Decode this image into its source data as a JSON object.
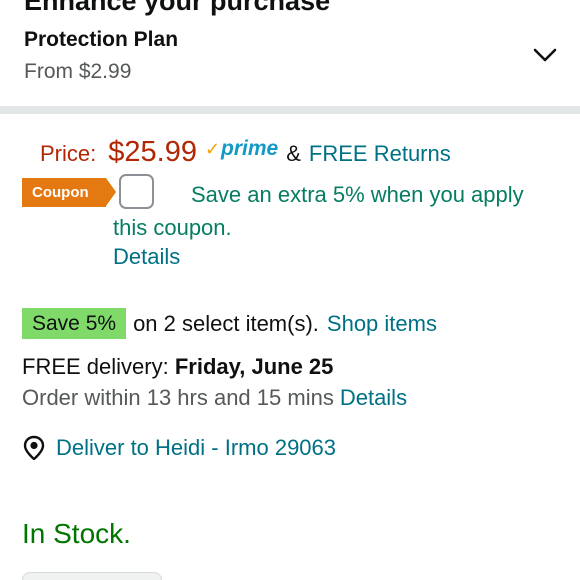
{
  "enhance": {
    "title": "Enhance your purchase"
  },
  "protection_plan": {
    "name": "Protection Plan",
    "price": "From $2.99",
    "expand_icon": "chevron-down-icon"
  },
  "price": {
    "label": "Price:",
    "value": "$25.99",
    "prime_check": "✓",
    "prime_word": "prime",
    "amp": "&",
    "free_returns": "FREE Returns"
  },
  "coupon": {
    "badge": "Coupon",
    "checked": false,
    "text": "Save an extra 5% when you apply this coupon.",
    "details": "Details"
  },
  "save_offer": {
    "badge": "Save 5%",
    "description": "on 2 select item(s).",
    "link": "Shop items"
  },
  "delivery": {
    "prefix": "FREE delivery:",
    "date": "Friday, June 25",
    "order_within": "Order within 13 hrs and 15 mins",
    "details": "Details"
  },
  "location": {
    "icon": "location-pin-icon",
    "text": "Deliver to Heidi - Irmo 29063"
  },
  "stock": {
    "status": "In Stock."
  },
  "colors": {
    "price_red": "#b12704",
    "link_teal": "#007185",
    "coupon_orange": "#e47911",
    "coupon_green": "#067d62",
    "save_badge_green": "#7fda69",
    "in_stock_green": "#007600",
    "prime_blue": "#1399c6"
  }
}
